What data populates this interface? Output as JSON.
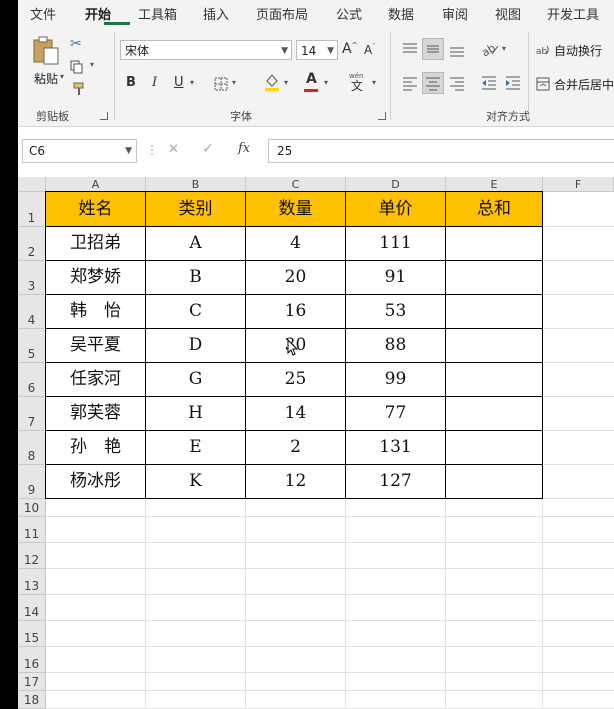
{
  "ribbon": {
    "tabs": [
      "文件",
      "开始",
      "工具箱",
      "插入",
      "页面布局",
      "公式",
      "数据",
      "审阅",
      "视图",
      "开发工具"
    ],
    "clipboard": {
      "paste": "粘贴",
      "group": "剪贴板"
    },
    "font": {
      "name": "宋体",
      "size": "14",
      "bold": "B",
      "italic": "I",
      "underline": "U",
      "color_a": "A",
      "group": "字体"
    },
    "alignment": {
      "wrap": "自动换行",
      "merge": "合并后居中",
      "group": "对齐方式"
    }
  },
  "formula_bar": {
    "name_box": "C6",
    "formula": "25",
    "fx": "fx"
  },
  "columns": [
    "A",
    "B",
    "C",
    "D",
    "E",
    "F"
  ],
  "rows": [
    "1",
    "2",
    "3",
    "4",
    "5",
    "6",
    "7",
    "8",
    "9",
    "10",
    "11",
    "12",
    "13",
    "14",
    "15",
    "16",
    "17",
    "18"
  ],
  "table": {
    "headers": [
      "姓名",
      "类别",
      "数量",
      "单价",
      "总和"
    ],
    "rows": [
      [
        "卫招弟",
        "A",
        "4",
        "111",
        ""
      ],
      [
        "郑梦娇",
        "B",
        "20",
        "91",
        ""
      ],
      [
        "韩　怡",
        "C",
        "16",
        "53",
        ""
      ],
      [
        "吴平夏",
        "D",
        "30",
        "88",
        ""
      ],
      [
        "任家河",
        "G",
        "25",
        "99",
        ""
      ],
      [
        "郭芙蓉",
        "H",
        "14",
        "77",
        ""
      ],
      [
        "孙　艳",
        "E",
        "2",
        "131",
        ""
      ],
      [
        "杨冰彤",
        "K",
        "12",
        "127",
        ""
      ]
    ]
  },
  "colors": {
    "header_fill": "#ffc000",
    "accent": "#217346",
    "font_color_bar": "#e01f1f",
    "fill_color_bar": "#ffd400"
  }
}
